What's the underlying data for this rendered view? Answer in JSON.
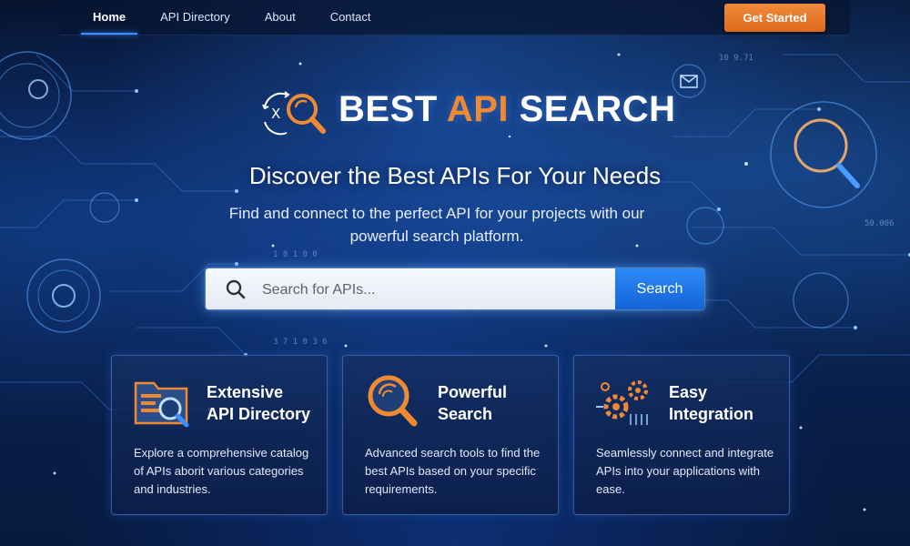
{
  "nav": {
    "links": [
      {
        "label": "Home",
        "active": true
      },
      {
        "label": "API Directory",
        "active": false
      },
      {
        "label": "About",
        "active": false
      },
      {
        "label": "Contact",
        "active": false
      }
    ],
    "cta_label": "Get Started"
  },
  "logo": {
    "text_before": "BEST ",
    "text_accent": "API",
    "text_after": " SEARCH",
    "icon": "search-with-x-arrows-icon"
  },
  "hero": {
    "headline": "Discover the Best APIs For Your Needs",
    "subhead": "Find and connect to the perfect API for your projects with our powerful search platform."
  },
  "search": {
    "placeholder": "Search for APIs...",
    "value": "",
    "button_label": "Search",
    "icon": "search-icon"
  },
  "features": [
    {
      "icon": "folder-magnifier-icon",
      "title_line1": "Extensive",
      "title_line2": "API Directory",
      "description": "Explore a comprehensive catalog of APIs aborit various categories and industries."
    },
    {
      "icon": "magnifier-icon",
      "title_line1": "Powerful",
      "title_line2": "Search",
      "description": "Advanced search tools to find the best APIs based on your specific requirements."
    },
    {
      "icon": "gears-icon",
      "title_line1": "Easy",
      "title_line2": "Integration",
      "description": "Seamlessly connect and integrate APIs into your applications with ease."
    }
  ],
  "colors": {
    "accent_orange": "#f08a32",
    "accent_blue": "#2d8af5",
    "background": "#0a2454"
  }
}
